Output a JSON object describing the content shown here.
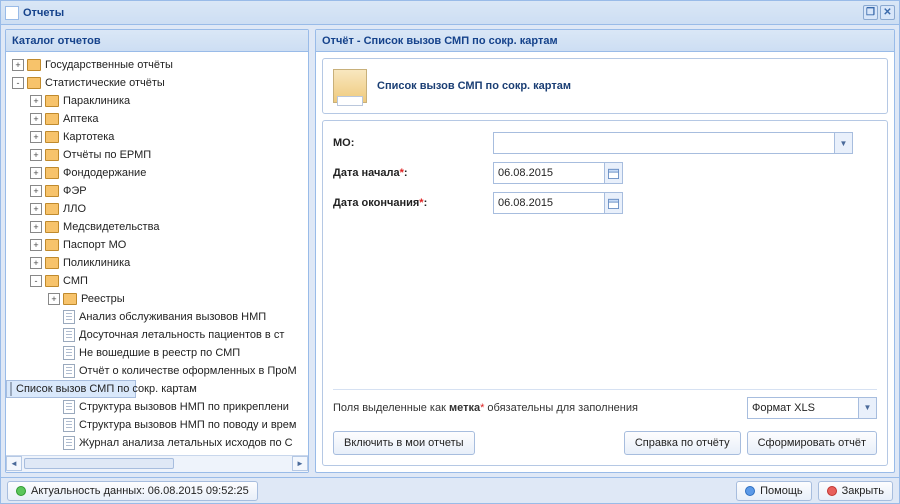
{
  "window": {
    "title": "Отчеты"
  },
  "catalog": {
    "title": "Каталог отчетов",
    "nodes": [
      {
        "id": "gos",
        "label": "Государственные отчёты",
        "kind": "folder",
        "indent": 0,
        "toggle": "+"
      },
      {
        "id": "stat",
        "label": "Статистические отчёты",
        "kind": "folder",
        "indent": 0,
        "toggle": "-"
      },
      {
        "id": "para",
        "label": "Параклиника",
        "kind": "folder",
        "indent": 1,
        "toggle": "+"
      },
      {
        "id": "apt",
        "label": "Аптека",
        "kind": "folder",
        "indent": 1,
        "toggle": "+"
      },
      {
        "id": "kart",
        "label": "Картотека",
        "kind": "folder",
        "indent": 1,
        "toggle": "+"
      },
      {
        "id": "ermp",
        "label": "Отчёты по ЕРМП",
        "kind": "folder",
        "indent": 1,
        "toggle": "+"
      },
      {
        "id": "fond",
        "label": "Фондодержание",
        "kind": "folder",
        "indent": 1,
        "toggle": "+"
      },
      {
        "id": "fer",
        "label": "ФЭР",
        "kind": "folder",
        "indent": 1,
        "toggle": "+"
      },
      {
        "id": "llo",
        "label": "ЛЛО",
        "kind": "folder",
        "indent": 1,
        "toggle": "+"
      },
      {
        "id": "med",
        "label": "Медсвидетельства",
        "kind": "folder",
        "indent": 1,
        "toggle": "+"
      },
      {
        "id": "pasp",
        "label": "Паспорт МО",
        "kind": "folder",
        "indent": 1,
        "toggle": "+"
      },
      {
        "id": "poli",
        "label": "Поликлиника",
        "kind": "folder",
        "indent": 1,
        "toggle": "+"
      },
      {
        "id": "smp",
        "label": "СМП",
        "kind": "folder",
        "indent": 1,
        "toggle": "-"
      },
      {
        "id": "reestr",
        "label": "Реестры",
        "kind": "folder",
        "indent": 2,
        "toggle": "+"
      },
      {
        "id": "d1",
        "label": "Анализ обслуживания вызовов НМП",
        "kind": "doc",
        "indent": 2
      },
      {
        "id": "d2",
        "label": "Досуточная летальность пациентов в ст",
        "kind": "doc",
        "indent": 2
      },
      {
        "id": "d3",
        "label": "Не вошедшие в реестр по СМП",
        "kind": "doc",
        "indent": 2
      },
      {
        "id": "d4",
        "label": "Отчёт о количестве оформленных в ПроМ",
        "kind": "doc",
        "indent": 2
      },
      {
        "id": "d5",
        "label": "Список вызов СМП по сокр. картам",
        "kind": "doc",
        "indent": 2,
        "selected": true
      },
      {
        "id": "d6",
        "label": "Структура вызовов НМП по прикреплени",
        "kind": "doc",
        "indent": 2
      },
      {
        "id": "d7",
        "label": "Структура вызовов НМП по поводу и врем",
        "kind": "doc",
        "indent": 2
      },
      {
        "id": "d8",
        "label": "Журнал анализа летальных исходов по С",
        "kind": "doc",
        "indent": 2
      }
    ]
  },
  "report": {
    "panel_title": "Отчёт - Список вызов СМП по сокр. картам",
    "card_title": "Список вызов СМП по сокр. картам",
    "fields": {
      "mo_label": "МО:",
      "mo_value": "",
      "date_start_label": "Дата начала",
      "date_start_value": "06.08.2015",
      "date_end_label": "Дата окончания",
      "date_end_value": "06.08.2015"
    },
    "hint_prefix": "Поля выделенные как ",
    "hint_bold": "метка",
    "hint_suffix": " обязательны для заполнения",
    "format_value": "Формат XLS",
    "btn_include": "Включить в мои отчеты",
    "btn_info": "Справка по отчёту",
    "btn_run": "Сформировать отчёт"
  },
  "status": {
    "freshness": "Актуальность данных: 06.08.2015 09:52:25",
    "help": "Помощь",
    "close": "Закрыть"
  }
}
